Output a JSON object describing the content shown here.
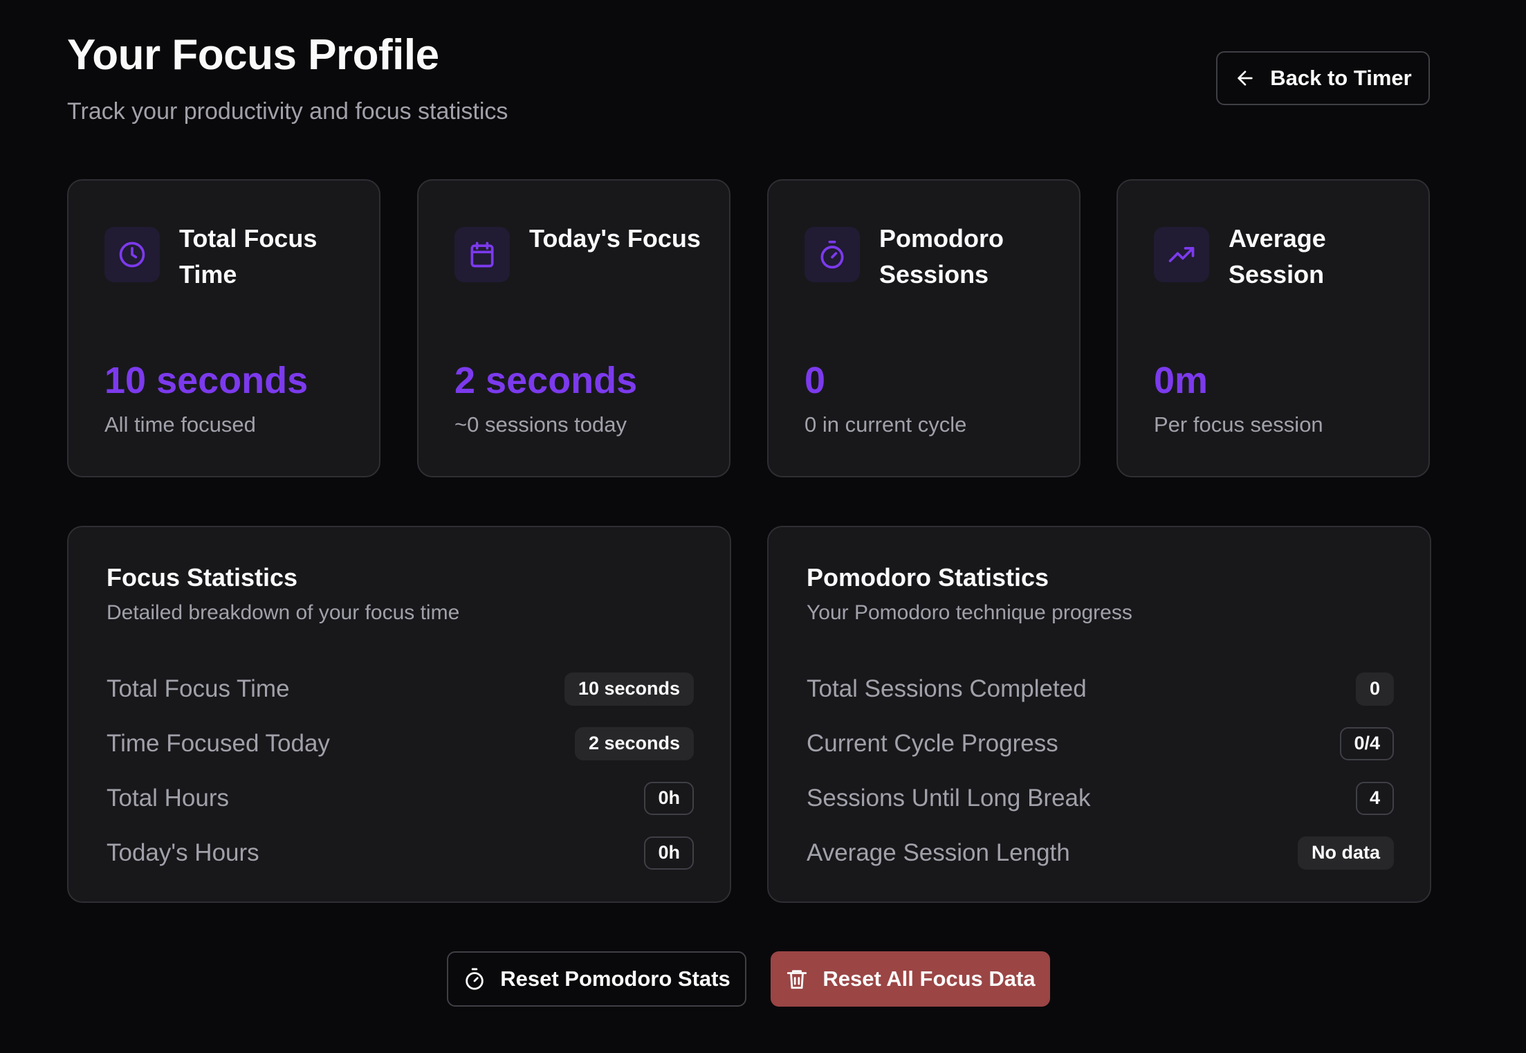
{
  "header": {
    "title": "Your Focus Profile",
    "subtitle": "Track your productivity and focus statistics",
    "back_label": "Back to Timer"
  },
  "stat_cards": [
    {
      "icon": "clock-icon",
      "title": "Total Focus Time",
      "value": "10 seconds",
      "description": "All time focused"
    },
    {
      "icon": "calendar-icon",
      "title": "Today's Focus",
      "value": "2 seconds",
      "description": "~0 sessions today"
    },
    {
      "icon": "timer-icon",
      "title": "Pomodoro Sessions",
      "value": "0",
      "description": "0 in current cycle"
    },
    {
      "icon": "trending-up-icon",
      "title": "Average Session",
      "value": "0m",
      "description": "Per focus session"
    }
  ],
  "focus_statistics": {
    "title": "Focus Statistics",
    "subtitle": "Detailed breakdown of your focus time",
    "rows": [
      {
        "label": "Total Focus Time",
        "value": "10 seconds"
      },
      {
        "label": "Time Focused Today",
        "value": "2 seconds"
      },
      {
        "label": "Total Hours",
        "value": "0h"
      },
      {
        "label": "Today's Hours",
        "value": "0h"
      }
    ]
  },
  "pomodoro_statistics": {
    "title": "Pomodoro Statistics",
    "subtitle": "Your Pomodoro technique progress",
    "rows": [
      {
        "label": "Total Sessions Completed",
        "value": "0"
      },
      {
        "label": "Current Cycle Progress",
        "value": "0/4"
      },
      {
        "label": "Sessions Until Long Break",
        "value": "4"
      },
      {
        "label": "Average Session Length",
        "value": "No data"
      }
    ]
  },
  "actions": {
    "reset_pomodoro_label": "Reset Pomodoro Stats",
    "reset_all_label": "Reset All Focus Data"
  },
  "colors": {
    "accent": "#7c3aed",
    "danger": "#9b4545",
    "background": "#09090b",
    "card": "#18181b"
  }
}
